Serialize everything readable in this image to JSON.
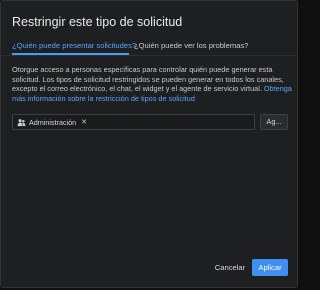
{
  "dialog": {
    "title": "Restringir este tipo de solicitud"
  },
  "tabs": [
    {
      "label": "¿Quién puede presentar solicitudes?",
      "active": true
    },
    {
      "label": "¿Quién puede ver los problemas?",
      "active": false
    }
  ],
  "description": {
    "text": "Otorgue acceso a personas específicas para controlar quién puede generar esta solicitud. Los tipos de solicitud restringidos se pueden generar en todos los canales, excepto el correo electrónico, el chat, el widget y el agente de servicio virtual. ",
    "link_text": "Obtenga más información sobre la restricción de tipos de solicitud"
  },
  "access_field": {
    "chip_label": "Administración",
    "chip_icon": "people-icon",
    "remove_icon": "close-icon"
  },
  "buttons": {
    "add_label": "Ag...",
    "cancel_label": "Cancelar",
    "apply_label": "Aplicar"
  },
  "colors": {
    "accent": "#3f8ef0",
    "link": "#5aa3ff",
    "background": "#1e1f21"
  }
}
